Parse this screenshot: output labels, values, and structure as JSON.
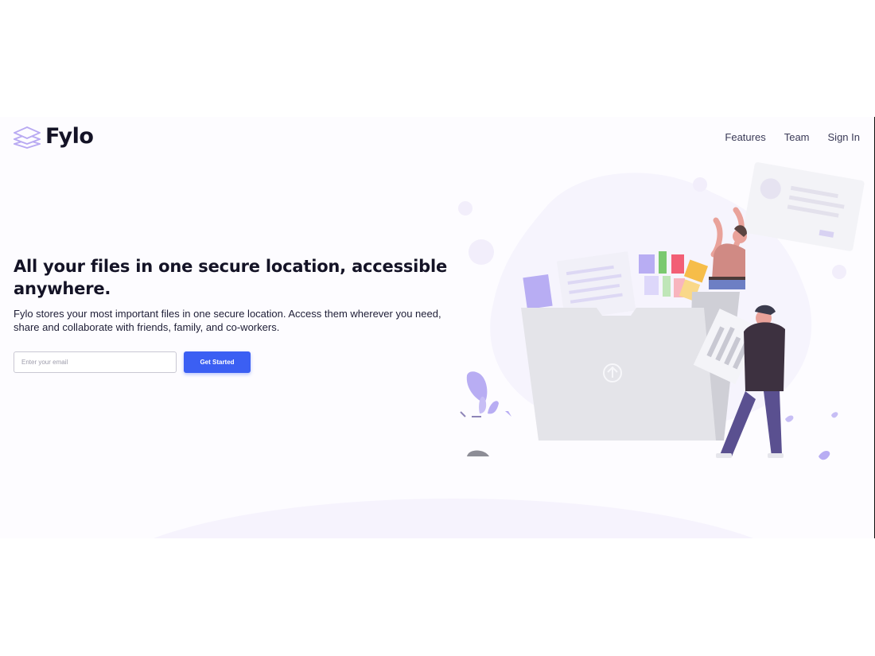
{
  "brand": {
    "name": "Fylo",
    "logo_icon": "stacked-layers-icon",
    "accent": "#3b5ff3",
    "logo_color": "#b8a9f2"
  },
  "nav": {
    "items": [
      "Features",
      "Team",
      "Sign In"
    ]
  },
  "hero": {
    "headline": "All your files in one secure location, accessible anywhere.",
    "subtext": "Fylo stores your most important files in one secure location. Access them wherever you need, share and collaborate with friends, family, and co-workers.",
    "email_placeholder": "Enter your email",
    "email_value": "",
    "cta_label": "Get Started"
  },
  "illustration": {
    "name": "file-folder-illustration"
  }
}
